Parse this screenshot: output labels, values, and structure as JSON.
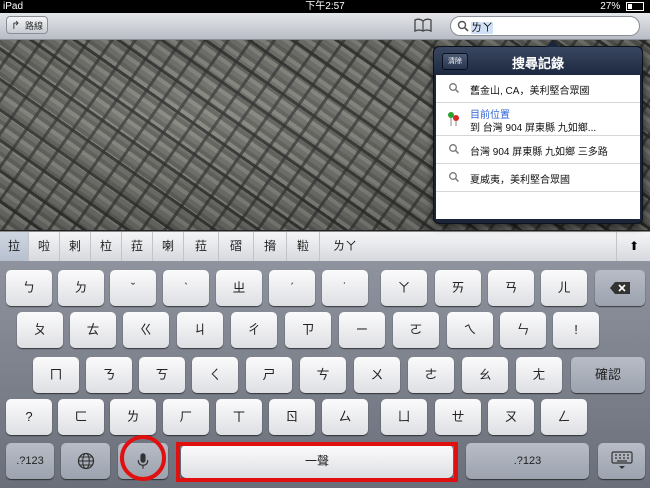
{
  "status": {
    "device": "iPad",
    "time": "下午2:57",
    "battery": "27%",
    "battery_level": 0.27
  },
  "navbar": {
    "route_label": "路線",
    "search_value": "ㄌㄚ"
  },
  "history": {
    "clear_label": "清除",
    "title": "搜尋記錄",
    "items": [
      {
        "line1": "舊金山, CA，美利堅合眾國",
        "line2": ""
      },
      {
        "line1": "目前位置",
        "line2": "到 台灣 904 屏東縣 九如鄉..."
      },
      {
        "line1": "台灣 904 屏東縣 九如鄉 三多路",
        "line2": ""
      },
      {
        "line1": "夏威夷，美利堅合眾國",
        "line2": ""
      }
    ]
  },
  "candidates": [
    "拉",
    "啦",
    "剌",
    "柆",
    "菈",
    "喇",
    "菈",
    "磖",
    "搚",
    "鞡",
    "ㄌㄚ"
  ],
  "candidate_toggle": "⬆",
  "keys": {
    "row1": [
      "ㄅ",
      "ㄉ",
      "ˇ",
      "ˋ",
      "ㄓ",
      "ˊ",
      "˙",
      "ㄚ",
      "ㄞ",
      "ㄢ",
      "ㄦ"
    ],
    "row2": [
      "ㄆ",
      "ㄊ",
      "ㄍ",
      "ㄐ",
      "ㄔ",
      "ㄗ",
      "ㄧ",
      "ㄛ",
      "ㄟ",
      "ㄣ",
      "!"
    ],
    "row3": [
      "ㄇ",
      "ㄋ",
      "ㄎ",
      "ㄑ",
      "ㄕ",
      "ㄘ",
      "ㄨ",
      "ㄜ",
      "ㄠ",
      "ㄤ"
    ],
    "row4": [
      "?",
      "ㄈ",
      "ㄌ",
      "ㄏ",
      "ㄒ",
      "ㄖ",
      "ㄙ",
      "ㄩ",
      "ㄝ",
      "ㄡ",
      "ㄥ"
    ],
    "confirm": "確認",
    "numbers_left": ".?123",
    "space": "一聲",
    "numbers_right": ".?123"
  },
  "icons": {
    "backspace": "backspace-icon",
    "globe": "globe-icon",
    "mic": "microphone-icon",
    "keyboard_hide": "keyboard-hide-icon"
  },
  "colors": {
    "annotation": "#e01010",
    "link_blue": "#2f63d8"
  }
}
